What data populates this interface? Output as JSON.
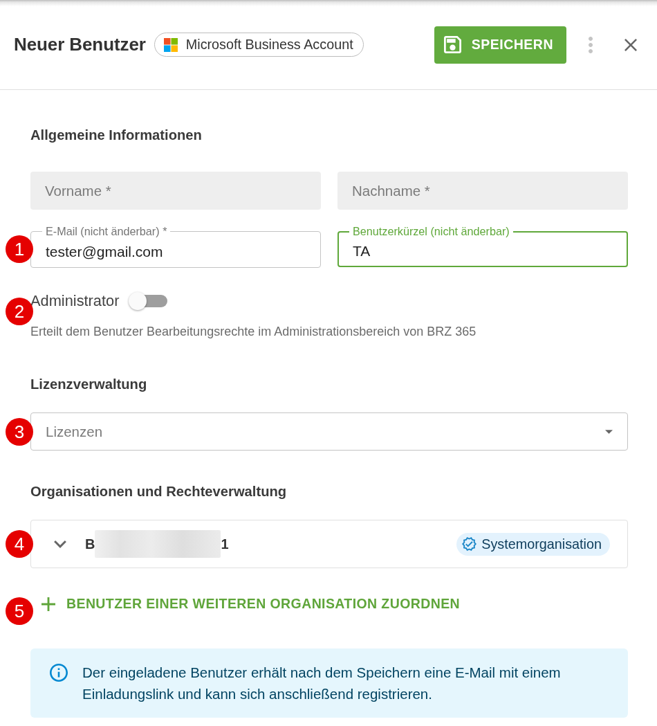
{
  "header": {
    "title": "Neuer Benutzer",
    "account_chip": "Microsoft Business Account",
    "save_button": "SPEICHERN"
  },
  "general": {
    "heading": "Allgemeine Informationen",
    "fields": [
      {
        "kind": "filled",
        "placeholder": "Vorname *"
      },
      {
        "kind": "filled",
        "placeholder": "Nachname *"
      },
      {
        "kind": "outlined",
        "label": "E-Mail (nicht änderbar) *",
        "value": "tester@gmail.com",
        "focused": false,
        "callout": "1"
      },
      {
        "kind": "outlined",
        "label": "Benutzerkürzel (nicht änderbar)",
        "value": "TA",
        "focused": true
      }
    ]
  },
  "administrator": {
    "label": "Administrator",
    "on": false,
    "description": "Erteilt dem Benutzer Bearbeitungsrechte im Administrationsbereich von BRZ 365",
    "callout": "2"
  },
  "licenses": {
    "heading": "Lizenzverwaltung",
    "placeholder": "Lizenzen",
    "callout": "3"
  },
  "organizations": {
    "heading": "Organisationen und Rechteverwaltung",
    "items": [
      {
        "name_start": "B",
        "name_end": "1",
        "redacted": true,
        "expanded": false,
        "badge": "Systemorganisation",
        "callout": "4"
      }
    ]
  },
  "add_organization": {
    "label": "BENUTZER EINER WEITEREN ORGANISATION ZUORDNEN",
    "callout": "5"
  },
  "info": {
    "text": "Der eingeladene Benutzer erhält nach dem Speichern eine E-Mail mit einem Einladungslink und kann sich anschließend registrieren."
  }
}
